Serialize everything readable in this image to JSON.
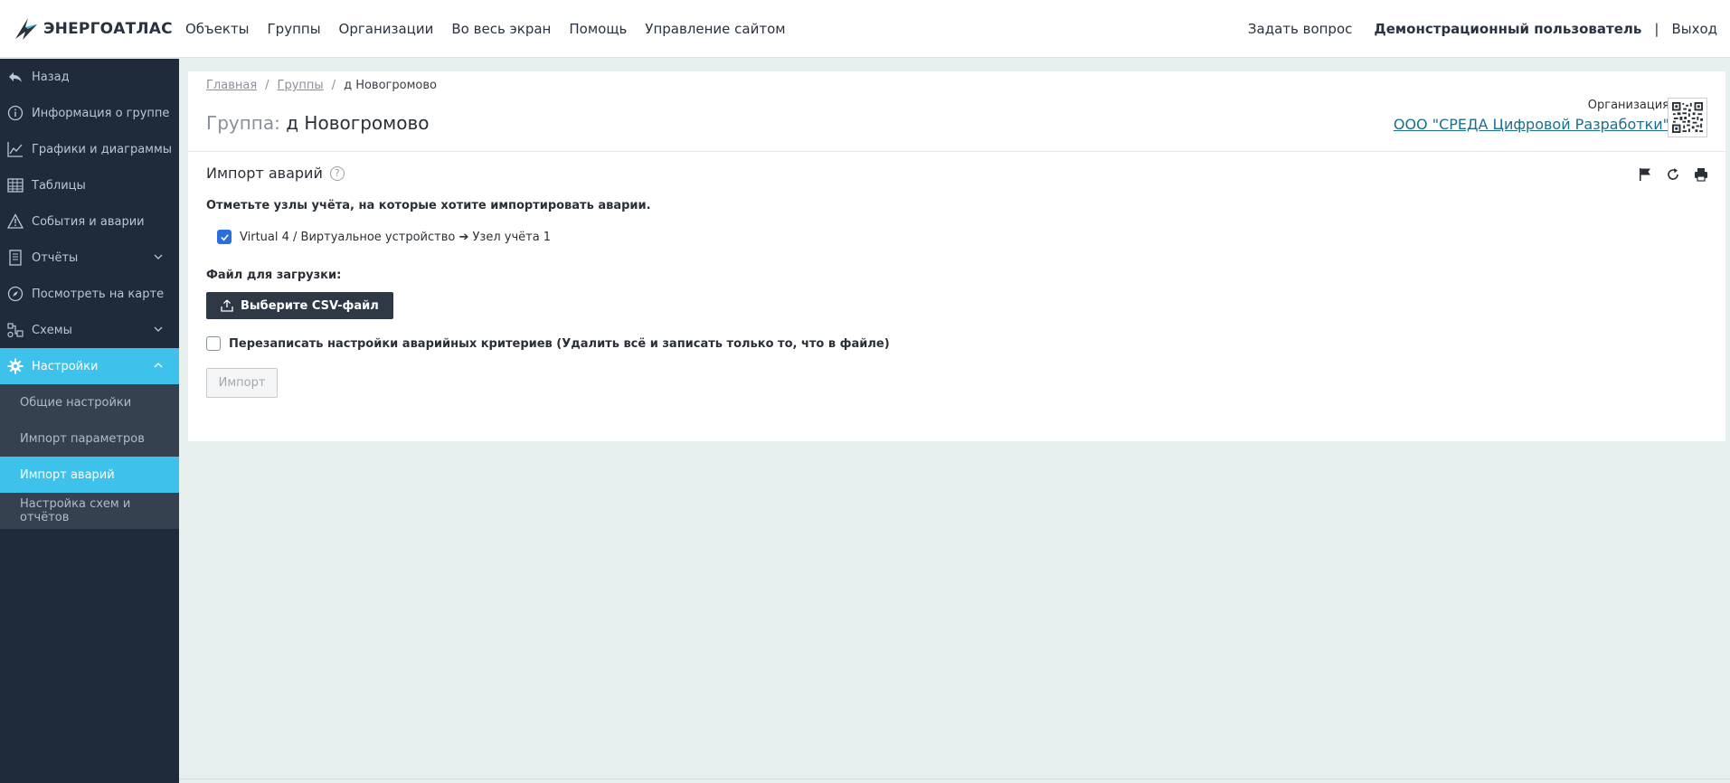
{
  "topbar": {
    "logo_text": "ЭНЕРГОАТЛАС",
    "nav": [
      "Объекты",
      "Группы",
      "Организации",
      "Во весь экран",
      "Помощь",
      "Управление сайтом"
    ],
    "ask": "Задать вопрос",
    "user": "Демонстрационный пользователь",
    "separator": "|",
    "logout": "Выход"
  },
  "sidebar": {
    "items": [
      {
        "label": "Назад",
        "icon": "back-arrow-icon"
      },
      {
        "label": "Информация о группе",
        "icon": "info-icon"
      },
      {
        "label": "Графики и диаграммы",
        "icon": "chart-line-icon"
      },
      {
        "label": "Таблицы",
        "icon": "table-icon"
      },
      {
        "label": "События и аварии",
        "icon": "warning-icon"
      },
      {
        "label": "Отчёты",
        "icon": "report-icon"
      },
      {
        "label": "Посмотреть на карте",
        "icon": "compass-icon"
      },
      {
        "label": "Схемы",
        "icon": "schema-icon"
      },
      {
        "label": "Настройки",
        "icon": "gear-icon"
      }
    ],
    "subitems": [
      {
        "label": "Общие настройки"
      },
      {
        "label": "Импорт параметров"
      },
      {
        "label": "Импорт аварий"
      },
      {
        "label": "Настройка схем и отчётов"
      }
    ]
  },
  "breadcrumb": {
    "home": "Главная",
    "groups": "Группы",
    "current": "д Новогромово"
  },
  "group": {
    "prefix": "Группа:",
    "name": "д Новогромово"
  },
  "org": {
    "label": "Организация",
    "name": "ООО \"СРЕДА Цифровой Разработки\""
  },
  "section": {
    "title": "Импорт аварий",
    "help": "?",
    "instruction": "Отметьте узлы учёта, на которые хотите импортировать аварии.",
    "node_label": "Virtual 4 / Виртуальное устройство ➔ Узел учёта 1",
    "file_label": "Файл для загрузки:",
    "file_button": "Выберите CSV-файл",
    "overwrite_label": "Перезаписать настройки аварийных критериев (Удалить всё и записать только то, что в файле)",
    "import_button": "Импорт"
  },
  "colors": {
    "sidebar_bg": "#1f2a3a",
    "accent": "#3ec2ec",
    "link": "#1c6e8c",
    "checkbox": "#2a6fdb"
  }
}
